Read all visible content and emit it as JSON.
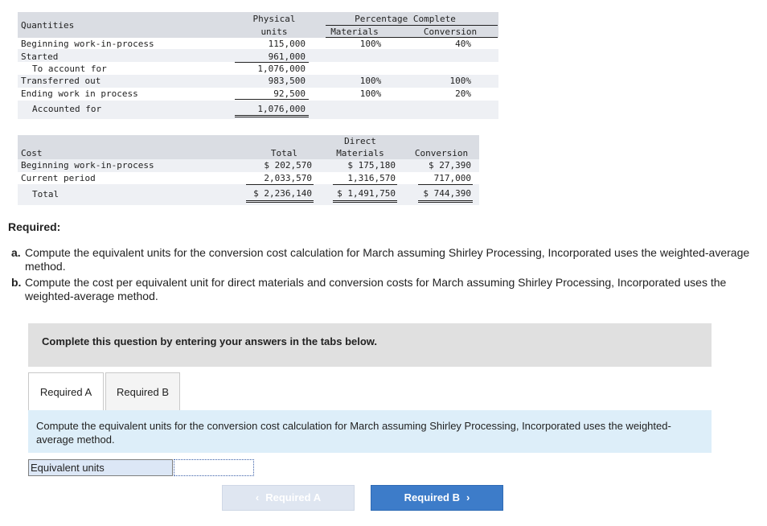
{
  "quantities": {
    "header": {
      "label": "Quantities",
      "physical_units_line1": "Physical",
      "physical_units_line2": "units",
      "pct_complete": "Percentage Complete",
      "materials": "Materials",
      "conversion": "Conversion"
    },
    "rows": [
      {
        "label": "Beginning work-in-process",
        "units": "115,000",
        "materials": "100%",
        "conversion": "40%"
      },
      {
        "label": "Started",
        "units": "961,000",
        "materials": "",
        "conversion": ""
      },
      {
        "label": "To account for",
        "units": "1,076,000",
        "materials": "",
        "conversion": ""
      },
      {
        "label": "Transferred out",
        "units": "983,500",
        "materials": "100%",
        "conversion": "100%"
      },
      {
        "label": "Ending work in process",
        "units": "92,500",
        "materials": "100%",
        "conversion": "20%"
      },
      {
        "label": "Accounted for",
        "units": "1,076,000",
        "materials": "",
        "conversion": ""
      }
    ]
  },
  "cost": {
    "header": {
      "label": "Cost",
      "total": "Total",
      "direct_line1": "Direct",
      "direct_line2": "Materials",
      "conversion": "Conversion"
    },
    "rows": [
      {
        "label": "Beginning work-in-process",
        "total": "$ 202,570",
        "materials": "$ 175,180",
        "conversion": "$ 27,390"
      },
      {
        "label": "Current period",
        "total": "2,033,570",
        "materials": "1,316,570",
        "conversion": "717,000"
      },
      {
        "label": "Total",
        "total": "$ 2,236,140",
        "materials": "$ 1,491,750",
        "conversion": "$ 744,390"
      }
    ]
  },
  "required": {
    "title": "Required:",
    "a_label": "a.",
    "a_text": "Compute the equivalent units for the conversion cost calculation for March assuming Shirley Processing, Incorporated uses the weighted-average method.",
    "b_label": "b.",
    "b_text": "Compute the cost per equivalent unit for direct materials and conversion costs for March assuming Shirley Processing, Incorporated uses the weighted-average method."
  },
  "instruction": "Complete this question by entering your answers in the tabs below.",
  "tabs": [
    {
      "label": "Required A",
      "active": true
    },
    {
      "label": "Required B",
      "active": false
    }
  ],
  "panel_text": "Compute the equivalent units for the conversion cost calculation for March assuming Shirley Processing, Incorporated uses the weighted-average method.",
  "answer": {
    "label": "Equivalent units",
    "value": ""
  },
  "nav": {
    "prev_label": "Required A",
    "prev_icon": "chevron-left-icon",
    "next_label": "Required B",
    "next_icon": "chevron-right-icon"
  },
  "colors": {
    "table_bg": "#eef0f4",
    "table_band": "#dadde3",
    "instruction_bg": "#e0e0e0",
    "panel_bg": "#ddeef9",
    "next_button": "#3d7cc9",
    "prev_button": "#dfe6f1"
  }
}
